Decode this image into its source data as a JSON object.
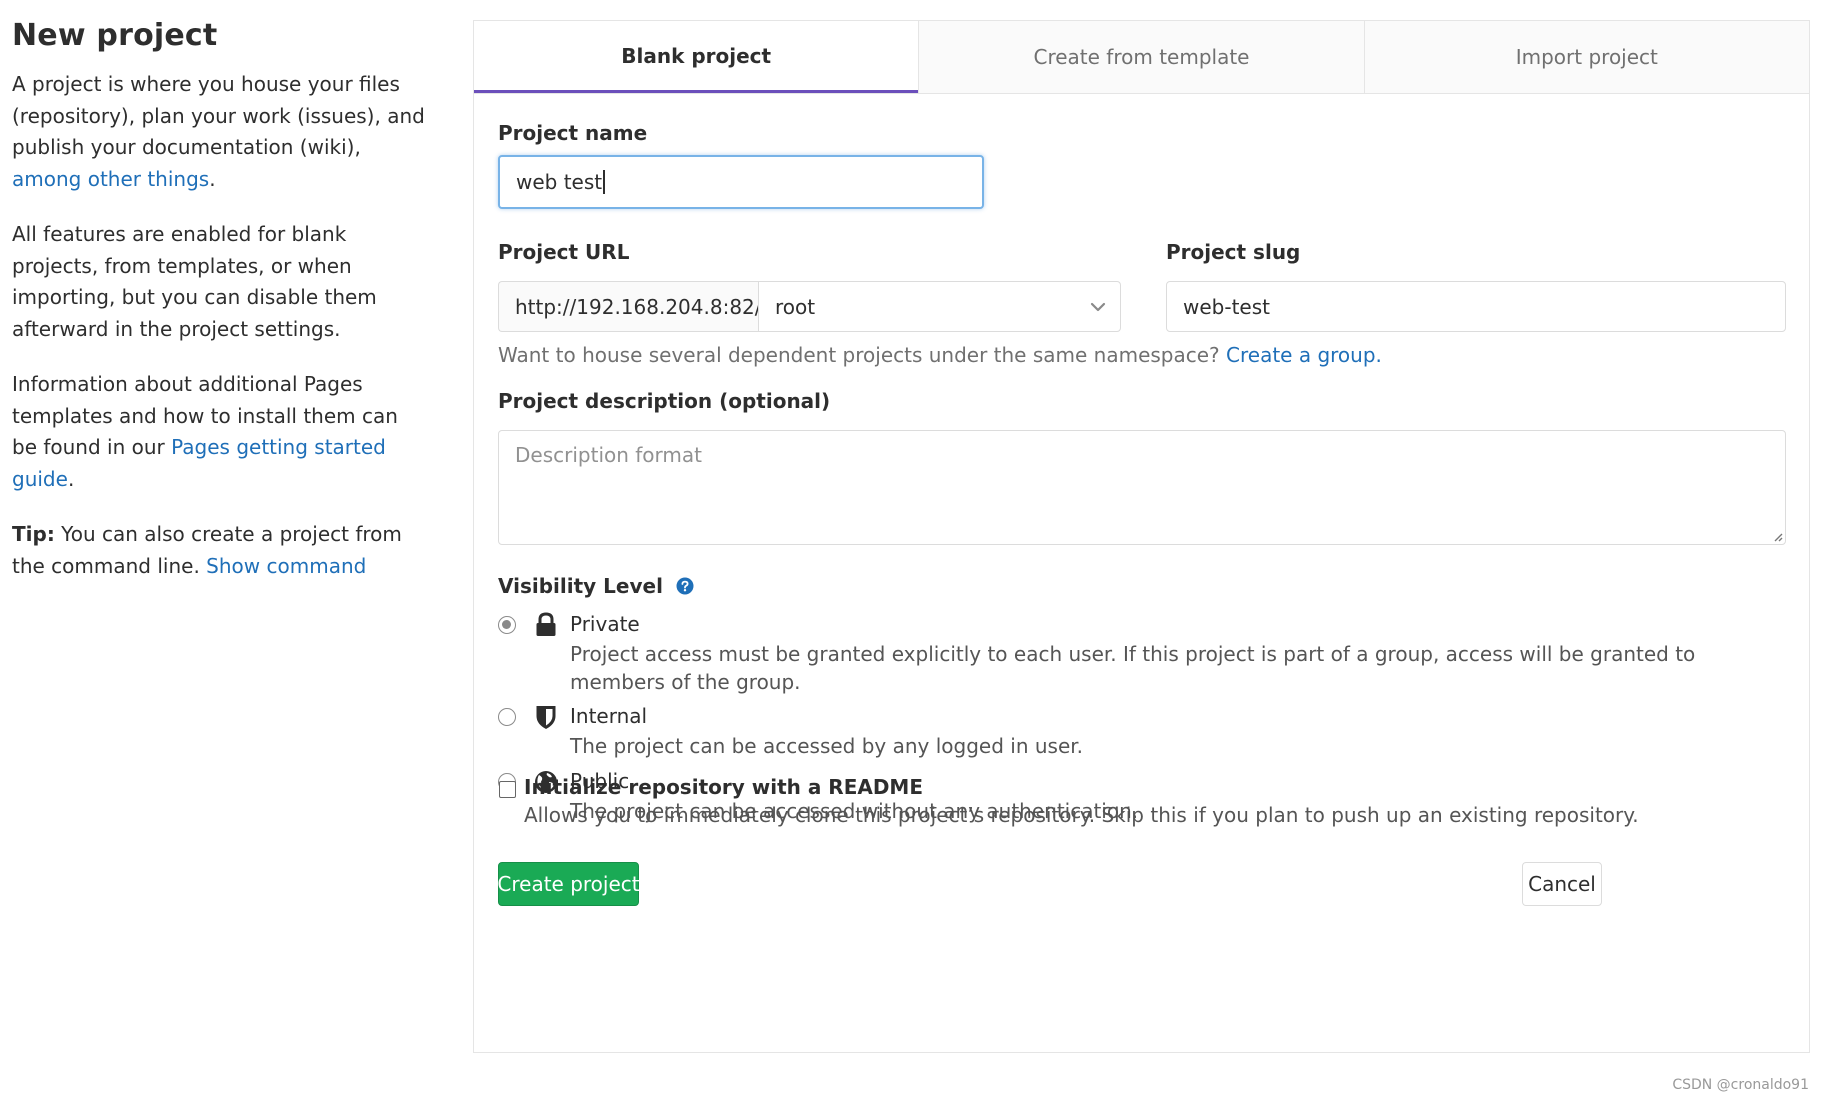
{
  "sidebar": {
    "title": "New project",
    "para1_text": "A project is where you house your files (repository), plan your work (issues), and publish your documentation (wiki), ",
    "para1_link": "among other things",
    "para1_end": ".",
    "para2": "All features are enabled for blank projects, from templates, or when importing, but you can disable them afterward in the project settings.",
    "para3_text": "Information about additional Pages templates and how to install them can be found in our ",
    "para3_link": "Pages getting started guide",
    "para3_end": ".",
    "tip_label": "Tip:",
    "tip_text": " You can also create a project from the command line. ",
    "tip_link": "Show command"
  },
  "tabs": [
    {
      "label": "Blank project",
      "active": true
    },
    {
      "label": "Create from template",
      "active": false
    },
    {
      "label": "Import project",
      "active": false
    }
  ],
  "form": {
    "project_name_label": "Project name",
    "project_name_value": "web test",
    "project_url_label": "Project URL",
    "url_prefix": "http://192.168.204.8:82/",
    "namespace_value": "root",
    "project_slug_label": "Project slug",
    "project_slug_value": "web-test",
    "namespace_help": "Want to house several dependent projects under the same namespace? ",
    "namespace_help_link": "Create a group.",
    "description_label": "Project description (optional)",
    "description_placeholder": "Description format",
    "visibility_label": "Visibility Level",
    "visibility_options": [
      {
        "title": "Private",
        "icon": "lock-icon",
        "checked": true,
        "description": "Project access must be granted explicitly to each user. If this project is part of a group, access will be granted to members of the group."
      },
      {
        "title": "Internal",
        "icon": "shield-icon",
        "checked": false,
        "description": "The project can be accessed by any logged in user."
      },
      {
        "title": "Public",
        "icon": "globe-icon",
        "checked": false,
        "description": "The project can be accessed without any authentication."
      }
    ],
    "readme_label": "Initialize repository with a README",
    "readme_help": "Allows you to immediately clone this project’s repository. Skip this if you plan to push up an existing repository.",
    "readme_checked": false,
    "create_button": "Create project",
    "cancel_button": "Cancel"
  },
  "colors": {
    "link": "#1f6fb8",
    "primary_button": "#1aaa55",
    "active_tab_underline": "#6b4fbb",
    "focus_border": "#78b3e7"
  },
  "watermark": "CSDN @cronaldo91"
}
